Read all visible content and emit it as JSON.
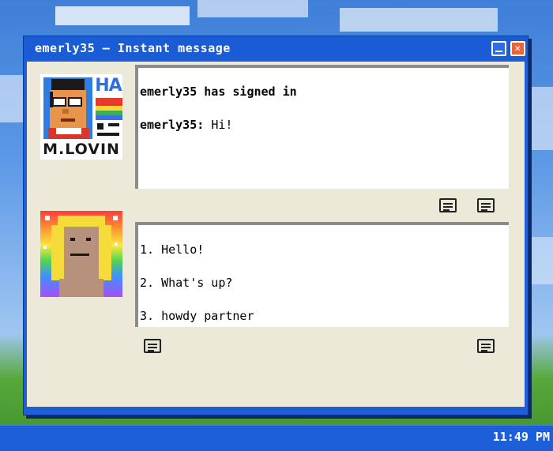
{
  "window": {
    "title": "emerly35 – Instant message",
    "close_glyph": "✕"
  },
  "buddy": {
    "avatar_caption_top": "HA",
    "avatar_caption_bottom": "M.LOVIN"
  },
  "conversation": {
    "status_line": "emerly35 has signed in",
    "messages": [
      {
        "sender": "emerly35:",
        "text": "Hi!"
      }
    ]
  },
  "replies": {
    "options": [
      "1. Hello!",
      "2. What's up?",
      "3. howdy partner"
    ]
  },
  "icons": {
    "sender_toolbar": [
      "message-icon",
      "message-icon"
    ],
    "reply_toolbar": [
      "message-icon",
      "message-icon"
    ],
    "window_controls": [
      "minimize-icon",
      "close-icon"
    ]
  },
  "colors": {
    "titlebar": "#1a5bd6",
    "window_body": "#ece9d8",
    "taskbar": "#1c5fd9",
    "close_button": "#e8643a"
  },
  "taskbar": {
    "clock": "11:49 PM"
  }
}
